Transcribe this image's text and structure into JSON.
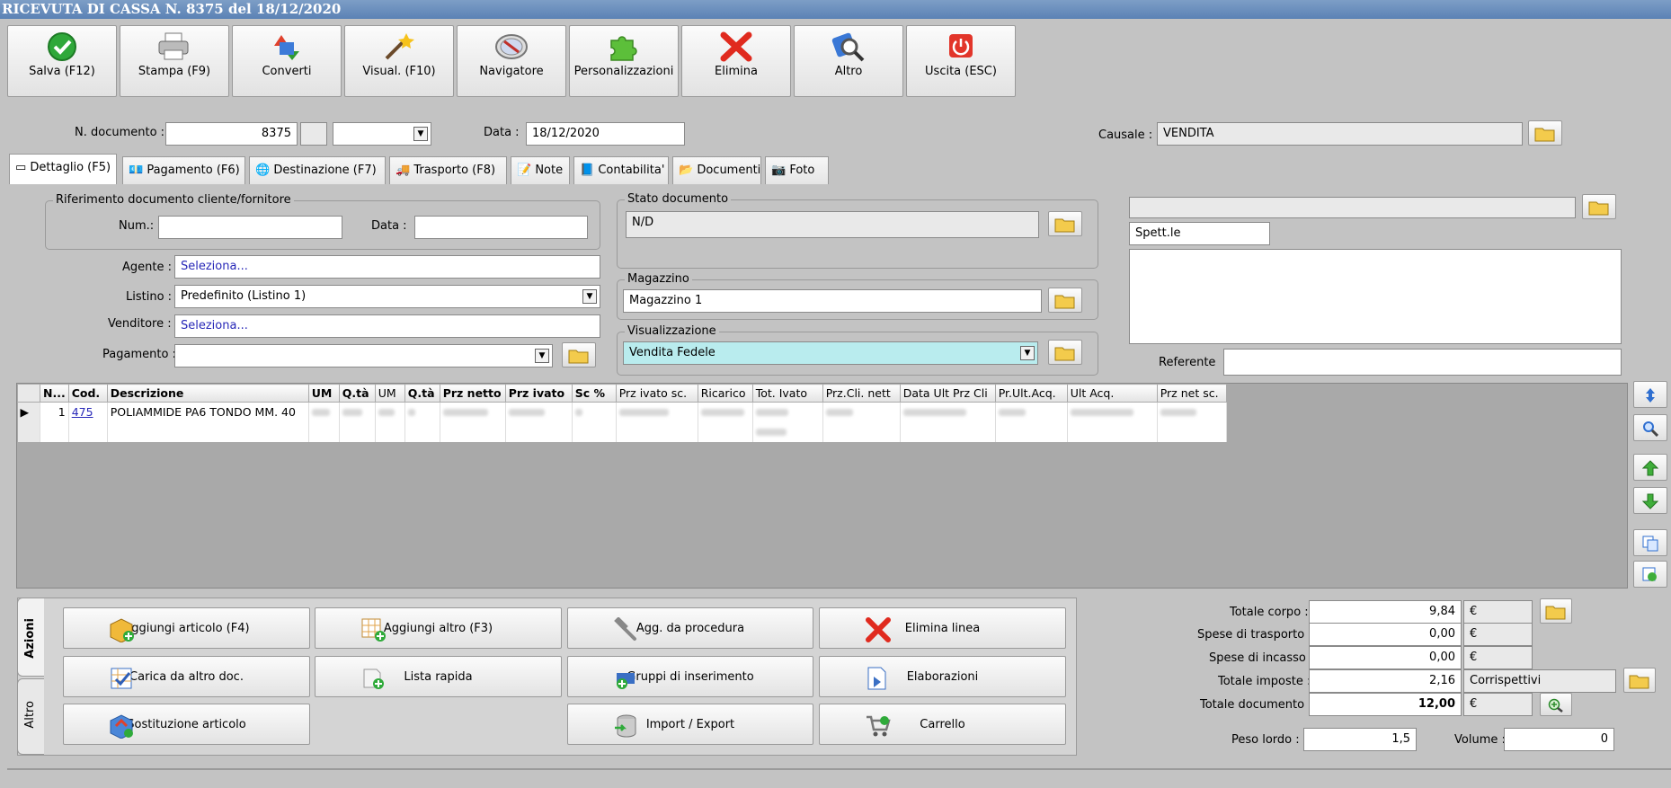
{
  "window": {
    "title": "RICEVUTA DI CASSA N. 8375 del 18/12/2020"
  },
  "toolbar": [
    {
      "label": "Salva (F12)",
      "icon": "check-icon"
    },
    {
      "label": "Stampa (F9)",
      "icon": "printer-icon"
    },
    {
      "label": "Converti",
      "icon": "convert-icon"
    },
    {
      "label": "Visual. (F10)",
      "icon": "magic-wand-icon"
    },
    {
      "label": "Navigatore",
      "icon": "compass-icon"
    },
    {
      "label": "Personalizzazioni",
      "icon": "puzzle-icon"
    },
    {
      "label": "Elimina",
      "icon": "delete-x-icon"
    },
    {
      "label": "Altro",
      "icon": "magnifier-icon"
    },
    {
      "label": "Uscita (ESC)",
      "icon": "power-icon"
    }
  ],
  "header": {
    "doc_number_label": "N. documento :",
    "doc_number": "8375",
    "date_label": "Data :",
    "date": "18/12/2020",
    "causale_label": "Causale :",
    "causale": "VENDITA"
  },
  "tabs": [
    "Dettaglio (F5)",
    "Pagamento (F6)",
    "Destinazione (F7)",
    "Trasporto (F8)",
    "Note",
    "Contabilita'",
    "Documenti",
    "Foto"
  ],
  "reference": {
    "group_label": "Riferimento documento cliente/fornitore",
    "num_label": "Num.:",
    "num": "",
    "date_label": "Data :",
    "date": ""
  },
  "fields": {
    "agente_label": "Agente :",
    "agente": "Seleziona...",
    "listino_label": "Listino :",
    "listino": "Predefinito (Listino 1)",
    "venditore_label": "Venditore :",
    "venditore": "Seleziona...",
    "pagamento_label": "Pagamento :",
    "pagamento": ""
  },
  "status": {
    "label": "Stato documento",
    "value": "N/D"
  },
  "warehouse": {
    "label": "Magazzino",
    "value": "Magazzino 1"
  },
  "view": {
    "label": "Visualizzazione",
    "value": "Vendita Fedele"
  },
  "customer": {
    "name": "",
    "title": "Spett.le",
    "address": "",
    "referente_label": "Referente",
    "referente": ""
  },
  "grid": {
    "columns": [
      "N...",
      "Cod.",
      "Descrizione",
      "UM",
      "Q.tà",
      "UM",
      "Q.tà",
      "Prz netto",
      "Prz ivato",
      "Sc %",
      "Prz ivato sc.",
      "Ricarico",
      "Tot. Ivato",
      "Prz.Cli. nett",
      "Data Ult Prz Cli",
      "Pr.Ult.Acq.",
      "Ult Acq.",
      "Prz net sc."
    ],
    "rows": [
      {
        "n": "1",
        "code": "475",
        "desc": "POLIAMMIDE PA6 TONDO MM.  40"
      }
    ]
  },
  "actions": {
    "vertical_tabs": [
      "Azioni",
      "Altro"
    ],
    "buttons": [
      {
        "label": "Aggiungi articolo (F4)",
        "icon": "add-article-icon"
      },
      {
        "label": "Aggiungi altro (F3)",
        "icon": "add-grid-icon"
      },
      {
        "label": "Agg. da procedura",
        "icon": "wrench-icon"
      },
      {
        "label": "Elimina linea",
        "icon": "delete-line-icon"
      },
      {
        "label": "Carica da altro doc.",
        "icon": "checklist-icon"
      },
      {
        "label": "Lista rapida",
        "icon": "quick-list-icon"
      },
      {
        "label": "Gruppi di inserimento",
        "icon": "group-insert-icon"
      },
      {
        "label": "Elaborazioni",
        "icon": "document-process-icon"
      },
      {
        "label": "Sostituzione articolo",
        "icon": "replace-article-icon"
      },
      {
        "label": "Import / Export",
        "icon": "database-icon"
      },
      {
        "label": "Carrello",
        "icon": "cart-icon"
      }
    ]
  },
  "totals": {
    "totale_corpo_label": "Totale corpo :",
    "totale_corpo": "9,84",
    "spese_trasporto_label": "Spese di trasporto :",
    "spese_trasporto": "0,00",
    "spese_incasso_label": "Spese di incasso :",
    "spese_incasso": "0,00",
    "totale_imposte_label": "Totale imposte :",
    "totale_imposte": "2,16",
    "imposte_type": "Corrispettivi",
    "totale_documento_label": "Totale documento :",
    "totale_documento": "12,00",
    "currency": "€",
    "peso_lordo_label": "Peso lordo :",
    "peso_lordo": "1,5",
    "volume_label": "Volume :",
    "volume": "0"
  }
}
